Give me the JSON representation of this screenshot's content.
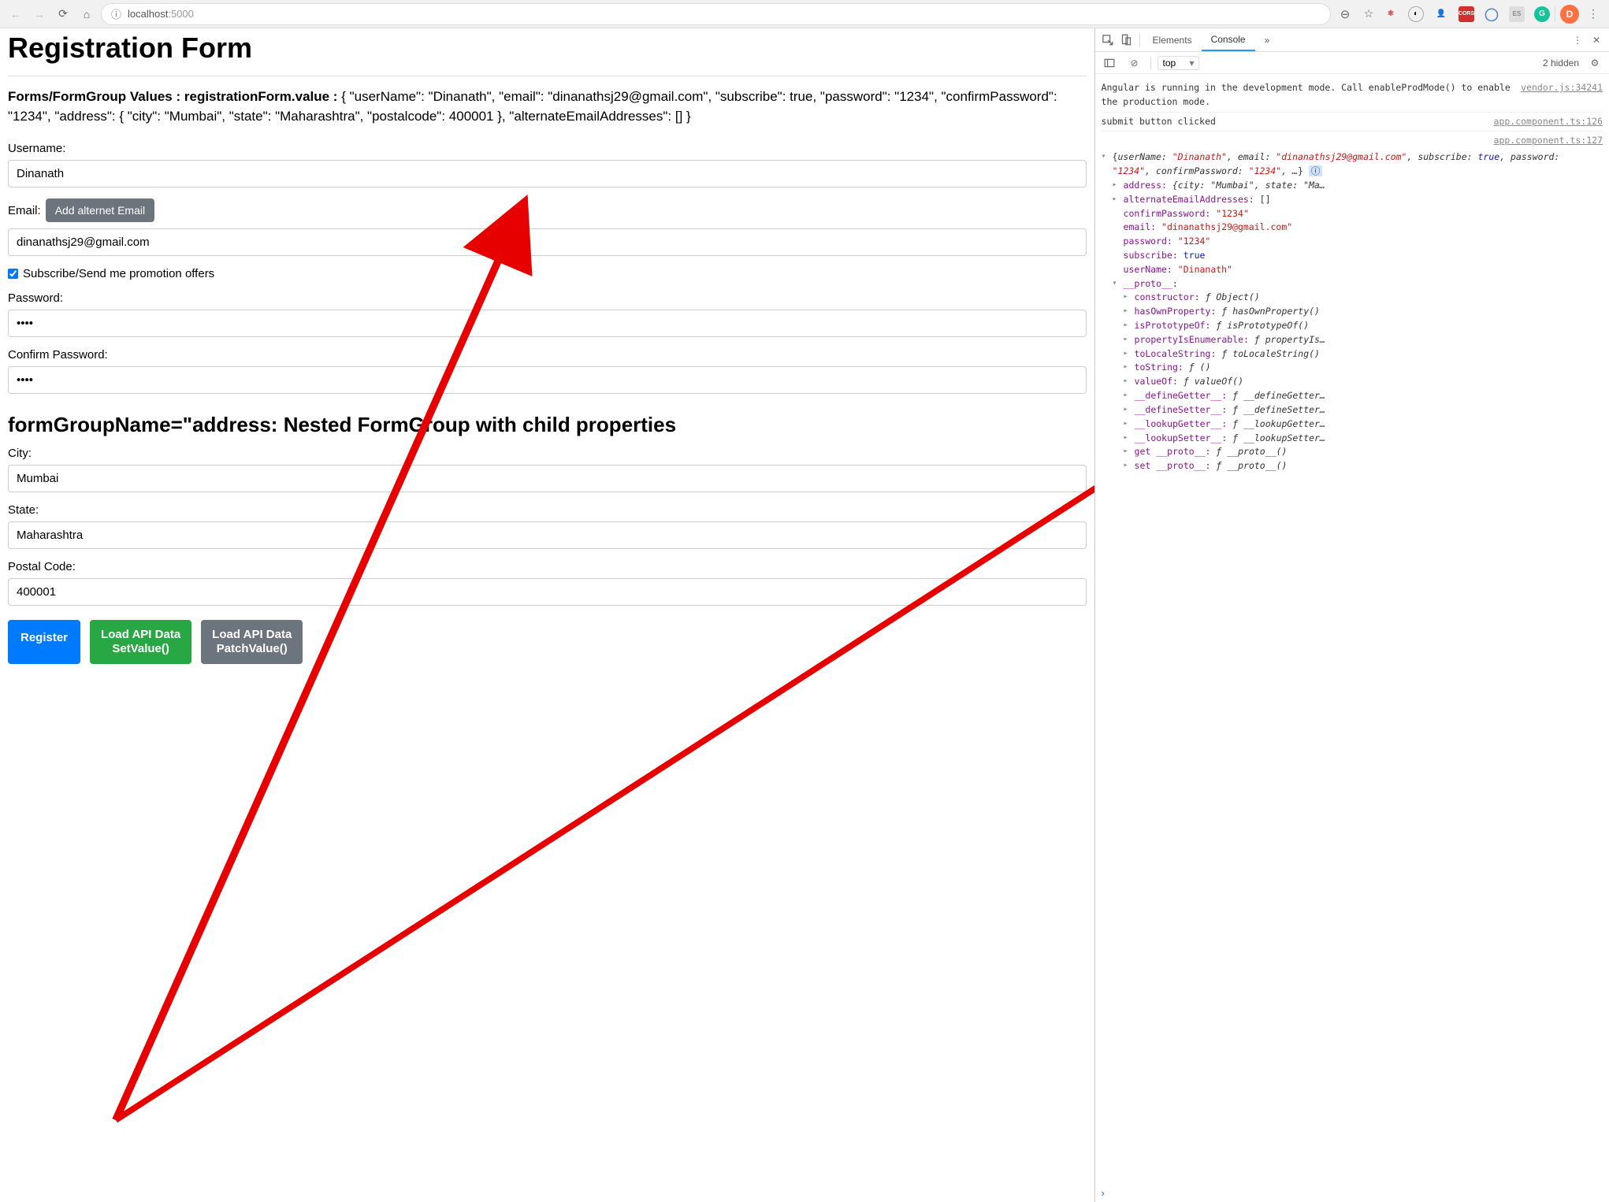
{
  "browser": {
    "url_host": "localhost",
    "url_port": ":5000",
    "avatar_initial": "D",
    "ext_cors": "CORS",
    "ext_es": "ES"
  },
  "page": {
    "title": "Registration Form",
    "dump_prefix": "Forms/FormGroup Values : registrationForm.value : ",
    "dump_json": "{ \"userName\": \"Dinanath\", \"email\": \"dinanathsj29@gmail.com\", \"subscribe\": true, \"password\": \"1234\", \"confirmPassword\": \"1234\", \"address\": { \"city\": \"Mumbai\", \"state\": \"Maharashtra\", \"postalcode\": 400001 }, \"alternateEmailAddresses\": [] }",
    "labels": {
      "username": "Username:",
      "email": "Email:",
      "add_email_btn": "Add alternet Email",
      "subscribe": "Subscribe/Send me promotion offers",
      "password": "Password:",
      "confirm_password": "Confirm Password:",
      "nested_heading": "formGroupName=\"address: Nested FormGroup with child properties",
      "city": "City:",
      "state": "State:",
      "postal": "Postal Code:"
    },
    "values": {
      "username": "Dinanath",
      "email": "dinanathsj29@gmail.com",
      "password": "••••",
      "confirm_password": "••••",
      "city": "Mumbai",
      "state": "Maharashtra",
      "postal": "400001"
    },
    "buttons": {
      "register": "Register",
      "load_set_top": "Load API Data",
      "load_set_bottom": "SetValue()",
      "load_patch_top": "Load API Data",
      "load_patch_bottom": "PatchValue()"
    }
  },
  "devtools": {
    "tabs": {
      "elements": "Elements",
      "console": "Console",
      "more": "»"
    },
    "toolbar": {
      "context": "top",
      "hidden": "2 hidden"
    },
    "msg_angular": "Angular is running in the development mode. Call enableProdMode() to enable the production mode.",
    "msg_angular_src": "vendor.js:34241",
    "msg_submit": "submit button clicked",
    "msg_submit_src": "app.component.ts:126",
    "obj_src": "app.component.ts:127",
    "obj_preview": "{userName: \"Dinanath\", email: \"dinanathsj29@gmail.com\", subscribe: true, password: \"1234\", confirmPassword: \"1234\", …}",
    "props": {
      "address_k": "address:",
      "address_v": "{city: \"Mumbai\", state: \"Ma…",
      "alt_k": "alternateEmailAddresses:",
      "alt_v": "[]",
      "confirm_k": "confirmPassword:",
      "confirm_v": "\"1234\"",
      "email_k": "email:",
      "email_v": "\"dinanathsj29@gmail.com\"",
      "password_k": "password:",
      "password_v": "\"1234\"",
      "subscribe_k": "subscribe:",
      "subscribe_v": "true",
      "username_k": "userName:",
      "username_v": "\"Dinanath\"",
      "proto_k": "__proto__",
      "colon": ":"
    },
    "proto": {
      "constructor_k": "constructor:",
      "constructor_v": "ƒ Object()",
      "hasOwn_k": "hasOwnProperty:",
      "hasOwn_v": "ƒ hasOwnProperty()",
      "isProto_k": "isPrototypeOf:",
      "isProto_v": "ƒ isPrototypeOf()",
      "propEnum_k": "propertyIsEnumerable:",
      "propEnum_v": "ƒ propertyIs…",
      "toLocale_k": "toLocaleString:",
      "toLocale_v": "ƒ toLocaleString()",
      "toString_k": "toString:",
      "toString_v": "ƒ ()",
      "valueOf_k": "valueOf:",
      "valueOf_v": "ƒ valueOf()",
      "defGet_k": "__defineGetter__:",
      "defGet_v": "ƒ __defineGetter…",
      "defSet_k": "__defineSetter__:",
      "defSet_v": "ƒ __defineSetter…",
      "lookGet_k": "__lookupGetter__:",
      "lookGet_v": "ƒ __lookupGetter…",
      "lookSet_k": "__lookupSetter__:",
      "lookSet_v": "ƒ __lookupSetter…",
      "getProto_k": "get __proto__:",
      "getProto_v": "ƒ __proto__()",
      "setProto_k": "set __proto__:",
      "setProto_v": "ƒ __proto__()"
    }
  }
}
